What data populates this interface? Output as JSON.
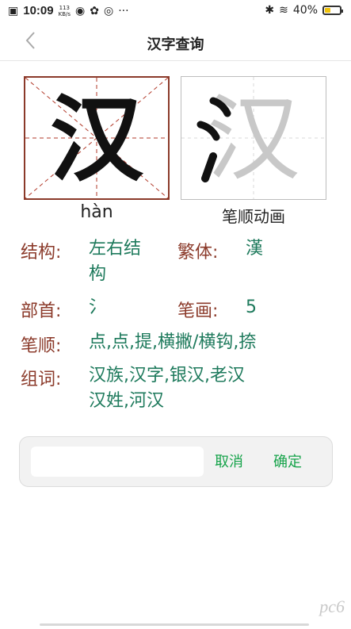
{
  "status_bar": {
    "time": "10:09",
    "net_speed_top": "113",
    "net_speed_bottom": "KB/s",
    "battery_percent": "40%",
    "battery_level": 0.4
  },
  "header": {
    "title": "汉字查询"
  },
  "character": {
    "glyph": "汉",
    "pinyin": "hàn",
    "animation_label": "笔顺动画"
  },
  "info": {
    "structure_label": "结构:",
    "structure_value_line1": "左右结",
    "structure_value_line2": "构",
    "traditional_label": "繁体:",
    "traditional_value": "漢",
    "radical_label": "部首:",
    "radical_value": "氵",
    "strokes_label": "笔画:",
    "strokes_value": "5",
    "order_label": "笔顺:",
    "order_value": "点,点,提,横撇/横钩,捺",
    "words_label": "组词:",
    "words_line1": "汉族,汉字,银汉,老汉",
    "words_line2": "汉姓,河汉"
  },
  "input_card": {
    "input_value": "",
    "cancel_label": "取消",
    "confirm_label": "确定"
  },
  "watermark": "pc6",
  "colors": {
    "label": "#8b3a2a",
    "value": "#1e7a5c",
    "action": "#16a34a",
    "battery": "#f0c20a"
  }
}
